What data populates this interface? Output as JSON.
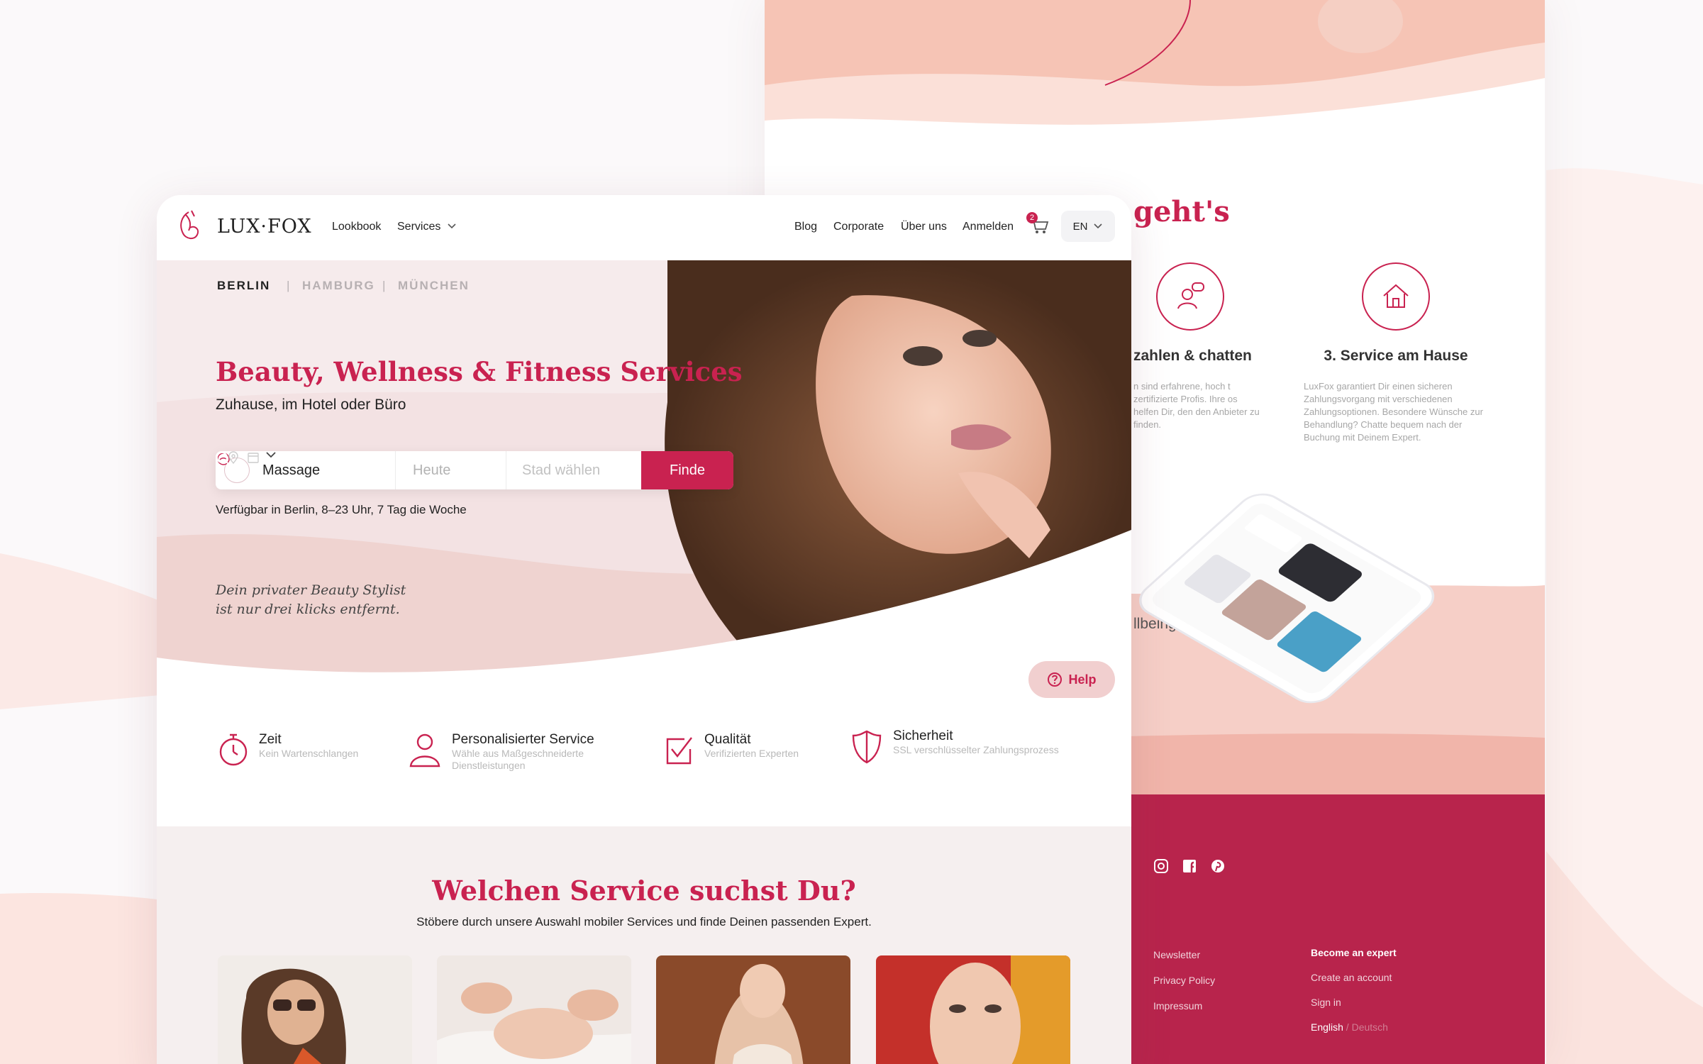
{
  "colors": {
    "accent": "#c92250",
    "footer": "#b8244c",
    "hero_bg": "#f6ebec",
    "section_bg": "#f5efef"
  },
  "nav": {
    "brand": "LUX·FOX",
    "left_links": [
      "Lookbook",
      "Services"
    ],
    "right_links": [
      "Blog",
      "Corporate",
      "Über uns",
      "Anmelden"
    ],
    "cart_count": "2",
    "language": "EN"
  },
  "hero": {
    "cities": {
      "active": "BERLIN",
      "others": [
        "HAMBURG",
        "MÜNCHEN"
      ],
      "separator": "|"
    },
    "title": "Beauty, Wellness & Fitness Services",
    "subtitle": "Zuhause, im Hotel oder Büro",
    "search": {
      "service": "Massage",
      "date": "Heute",
      "city_placeholder": "Stad wählen",
      "button": "Finde"
    },
    "availability": "Verfügbar in Berlin, 8–23 Uhr, 7 Tag die Woche",
    "tagline_1": "Dein privater Beauty Stylist",
    "tagline_2": "ist nur drei klicks entfernt."
  },
  "help": "Help",
  "features": [
    {
      "title": "Zeit",
      "text": "Kein Wartenschlangen",
      "icon": "stopwatch-icon"
    },
    {
      "title": "Personalisierter Service",
      "text": "Wähle aus Maßgeschneiderte Dienstleistungen",
      "icon": "person-icon"
    },
    {
      "title": "Qualität",
      "text": "Verifizierten Experten",
      "icon": "checkbox-icon"
    },
    {
      "title": "Sicherheit",
      "text": "SSL verschlüsselter Zahlungsprozess",
      "icon": "shield-icon"
    }
  ],
  "services_section": {
    "title": "Welchen Service suchst Du?",
    "subtitle": "Stöbere durch unsere Auswahl mobiler Services und finde Deinen passenden Expert."
  },
  "back_page": {
    "how_title": "geht's",
    "step2": {
      "title": "zahlen & chatten",
      "text": "n sind erfahrene, hoch t zertifizierte Profis. Ihre os helfen Dir, den den Anbieter zu finden."
    },
    "step3": {
      "title": "3. Service am Hause",
      "text": "LuxFox garantiert Dir einen sicheren Zahlungsvorgang mit verschiedenen Zahlungsoptionen. Besondere Wünsche zur Behandlung? Chatte bequem nach der Buchung mit Deinem Expert."
    },
    "wellbeing": "llbeing",
    "footer": {
      "col1": [
        "Newsletter",
        "Privacy Policy",
        "Impressum"
      ],
      "col2_title": "Become an expert",
      "col2": [
        "Create an account",
        "Sign in"
      ],
      "lang_en": "English",
      "lang_sep": " / ",
      "lang_de": "Deutsch"
    }
  }
}
